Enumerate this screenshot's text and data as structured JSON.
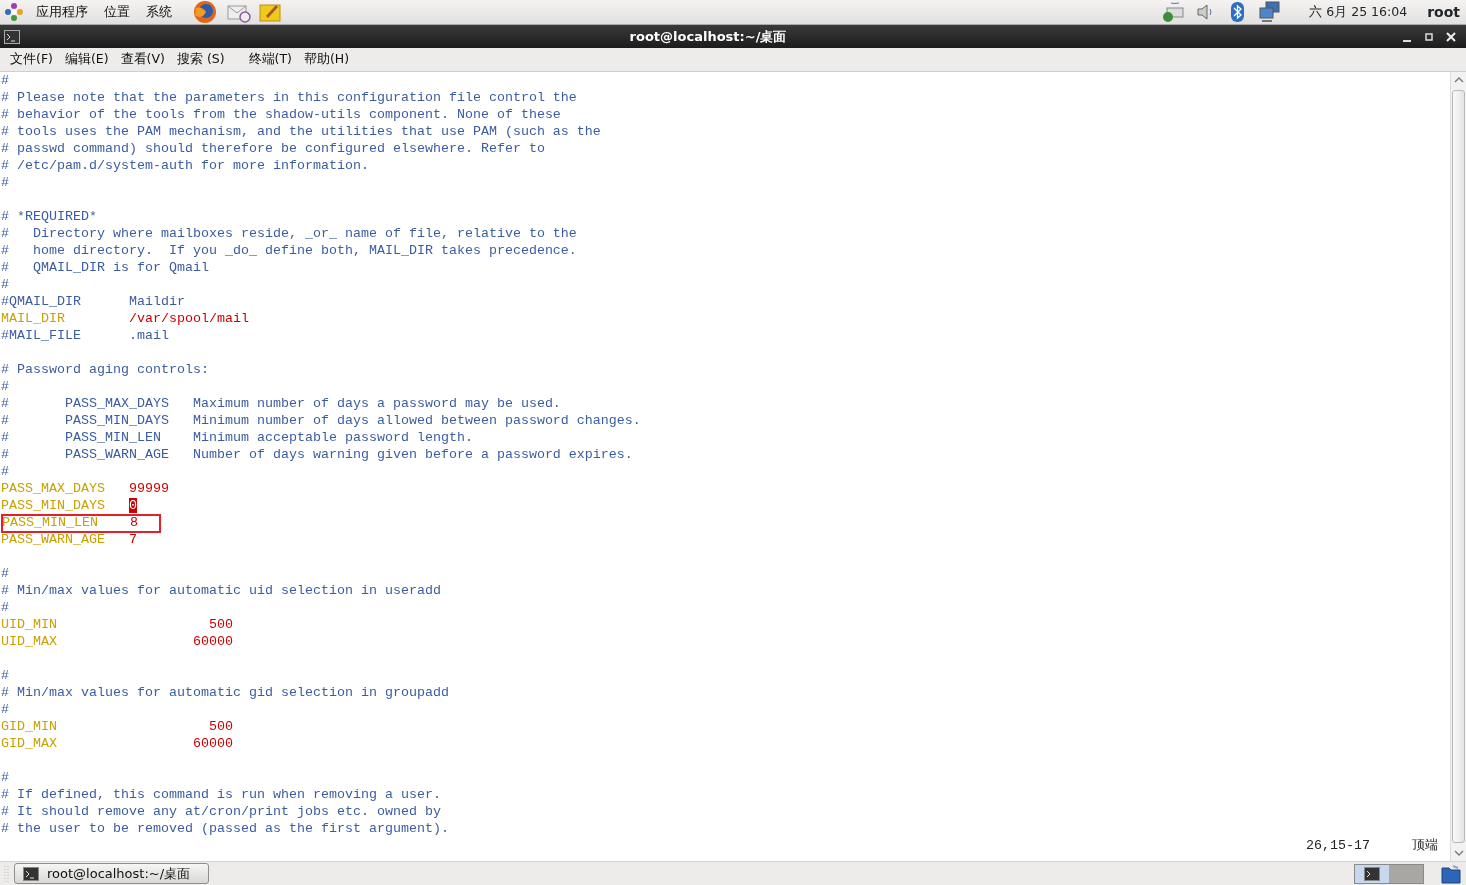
{
  "top_panel": {
    "menus": [
      "应用程序",
      "位置",
      "系统"
    ],
    "clock": "六 6月 25 16:04",
    "user": "root"
  },
  "window": {
    "title": "root@localhost:~/桌面",
    "menu": [
      "文件(F)",
      "编辑(E)",
      "查看(V)",
      "搜索 (S)",
      "终端(T)",
      "帮助(H)"
    ]
  },
  "editor": {
    "lines": [
      {
        "kind": "comment",
        "text": "#"
      },
      {
        "kind": "comment",
        "text": "# Please note that the parameters in this configuration file control the"
      },
      {
        "kind": "comment",
        "text": "# behavior of the tools from the shadow-utils component. None of these"
      },
      {
        "kind": "comment",
        "text": "# tools uses the PAM mechanism, and the utilities that use PAM (such as the"
      },
      {
        "kind": "comment",
        "text": "# passwd command) should therefore be configured elsewhere. Refer to"
      },
      {
        "kind": "comment",
        "text": "# /etc/pam.d/system-auth for more information."
      },
      {
        "kind": "comment",
        "text": "#"
      },
      {
        "kind": "blank"
      },
      {
        "kind": "comment",
        "text": "# *REQUIRED*"
      },
      {
        "kind": "comment",
        "text": "#   Directory where mailboxes reside, _or_ name of file, relative to the"
      },
      {
        "kind": "comment",
        "text": "#   home directory.  If you _do_ define both, MAIL_DIR takes precedence."
      },
      {
        "kind": "comment",
        "text": "#   QMAIL_DIR is for Qmail"
      },
      {
        "kind": "comment",
        "text": "#"
      },
      {
        "kind": "comment",
        "text": "#QMAIL_DIR      Maildir"
      },
      {
        "kind": "setting",
        "key": "MAIL_DIR",
        "value": "/var/spool/mail"
      },
      {
        "kind": "comment",
        "text": "#MAIL_FILE      .mail"
      },
      {
        "kind": "blank"
      },
      {
        "kind": "comment",
        "text": "# Password aging controls:"
      },
      {
        "kind": "comment",
        "text": "#"
      },
      {
        "kind": "comment",
        "text": "#       PASS_MAX_DAYS   Maximum number of days a password may be used."
      },
      {
        "kind": "comment",
        "text": "#       PASS_MIN_DAYS   Minimum number of days allowed between password changes."
      },
      {
        "kind": "comment",
        "text": "#       PASS_MIN_LEN    Minimum acceptable password length."
      },
      {
        "kind": "comment",
        "text": "#       PASS_WARN_AGE   Number of days warning given before a password expires."
      },
      {
        "kind": "comment",
        "text": "#"
      },
      {
        "kind": "setting",
        "key": "PASS_MAX_DAYS",
        "value": "99999"
      },
      {
        "kind": "setting",
        "key": "PASS_MIN_DAYS",
        "value": "0",
        "cursor": true
      },
      {
        "kind": "setting",
        "key": "PASS_MIN_LEN",
        "value": "8",
        "highlighted": true
      },
      {
        "kind": "setting",
        "key": "PASS_WARN_AGE",
        "value": "7"
      },
      {
        "kind": "blank"
      },
      {
        "kind": "comment",
        "text": "#"
      },
      {
        "kind": "comment",
        "text": "# Min/max values for automatic uid selection in useradd"
      },
      {
        "kind": "comment",
        "text": "#"
      },
      {
        "kind": "range_setting",
        "key": "UID_MIN",
        "value": "500"
      },
      {
        "kind": "range_setting",
        "key": "UID_MAX",
        "value": "60000"
      },
      {
        "kind": "blank"
      },
      {
        "kind": "comment",
        "text": "#"
      },
      {
        "kind": "comment",
        "text": "# Min/max values for automatic gid selection in groupadd"
      },
      {
        "kind": "comment",
        "text": "#"
      },
      {
        "kind": "range_setting",
        "key": "GID_MIN",
        "value": "500"
      },
      {
        "kind": "range_setting",
        "key": "GID_MAX",
        "value": "60000"
      },
      {
        "kind": "blank"
      },
      {
        "kind": "comment",
        "text": "#"
      },
      {
        "kind": "comment",
        "text": "# If defined, this command is run when removing a user."
      },
      {
        "kind": "comment",
        "text": "# It should remove any at/cron/print jobs etc. owned by"
      },
      {
        "kind": "comment",
        "text": "# the user to be removed (passed as the first argument)."
      }
    ],
    "status": {
      "position": "26,15-17",
      "scroll": "顶端"
    }
  },
  "taskbar": {
    "tasks": [
      {
        "label": "root@localhost:~/桌面"
      }
    ]
  }
}
